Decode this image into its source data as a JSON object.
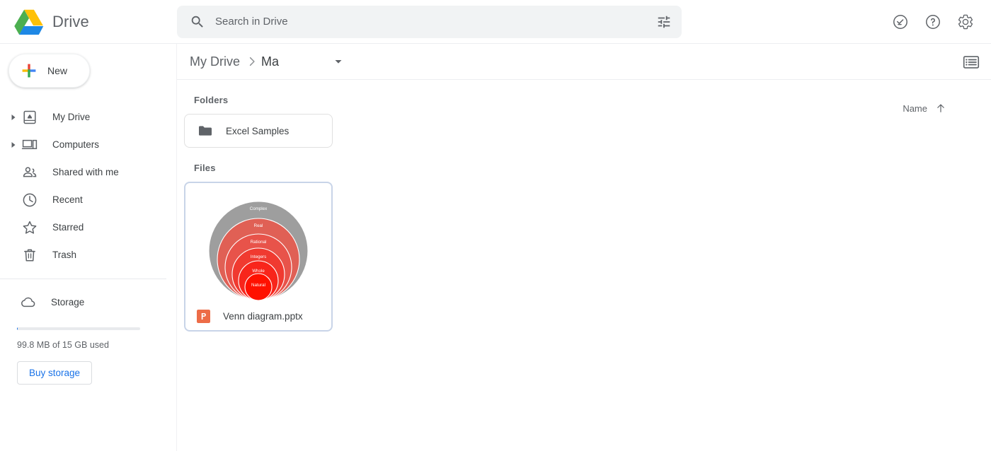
{
  "header": {
    "brand": "Drive",
    "logo_icon": "drive-triangle-logo",
    "search": {
      "placeholder": "Search in Drive",
      "value": "",
      "search_icon": "search-icon",
      "filter_icon": "tune-filter-icon"
    },
    "actions": [
      {
        "name": "support-icon",
        "label": "Support"
      },
      {
        "name": "help-icon",
        "label": "Help"
      },
      {
        "name": "settings-gear-icon",
        "label": "Settings"
      }
    ]
  },
  "sidebar": {
    "new_button": {
      "label": "New",
      "icon": "plus-icon"
    },
    "items": [
      {
        "label": "My Drive",
        "icon": "my-drive-icon",
        "expandable": true
      },
      {
        "label": "Computers",
        "icon": "computers-icon",
        "expandable": true
      },
      {
        "label": "Shared with me",
        "icon": "shared-with-me-icon",
        "expandable": false
      },
      {
        "label": "Recent",
        "icon": "clock-icon",
        "expandable": false
      },
      {
        "label": "Starred",
        "icon": "star-icon",
        "expandable": false
      },
      {
        "label": "Trash",
        "icon": "trash-icon",
        "expandable": false
      }
    ],
    "storage": {
      "label": "Storage",
      "icon": "cloud-icon",
      "used_text": "99.8 MB of 15 GB used",
      "percent_used": 0.65,
      "buy_button": "Buy storage",
      "accent_color": "#1a73e8"
    }
  },
  "main": {
    "breadcrumb": {
      "root": "My Drive",
      "current": "Ma",
      "separator_icon": "chevron-right-icon",
      "dropdown_icon": "caret-down-icon"
    },
    "list_view_icon": "list-view-icon",
    "sort": {
      "label": "Name",
      "direction_icon": "arrow-up-icon"
    },
    "sections": {
      "folders_title": "Folders",
      "files_title": "Files"
    },
    "folders": [
      {
        "name": "Excel Samples",
        "icon": "folder-icon"
      }
    ],
    "files": [
      {
        "name": "Venn diagram.pptx",
        "type_icon": "powerpoint-icon",
        "type_color": "#ed6c47",
        "selected": true,
        "thumbnail": {
          "kind": "nested-venn-diagram",
          "rings": [
            {
              "label": "Complex",
              "color": "#9e9e9e"
            },
            {
              "label": "Real",
              "color": "#e06055"
            },
            {
              "label": "Rational",
              "color": "#e8534a"
            },
            {
              "label": "Integers",
              "color": "#f03a30"
            },
            {
              "label": "Whole",
              "color": "#f8251b"
            },
            {
              "label": "Natural",
              "color": "#ff1100"
            }
          ]
        }
      }
    ]
  }
}
